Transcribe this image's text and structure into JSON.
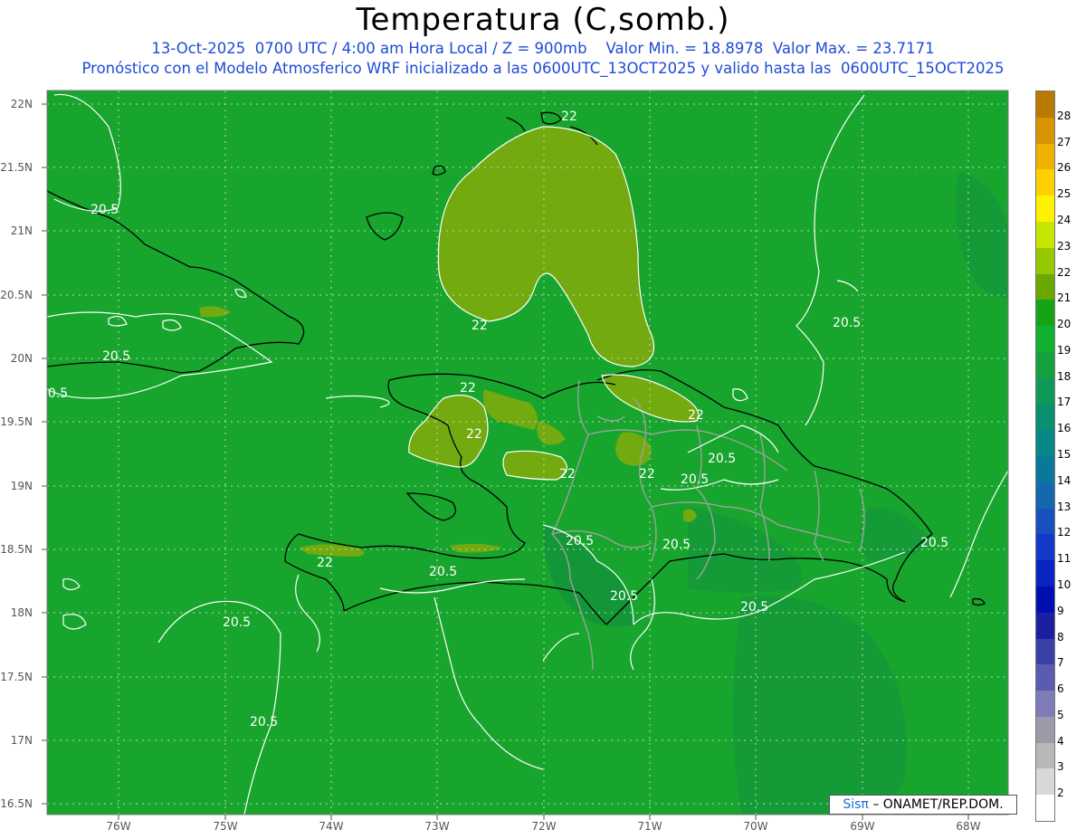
{
  "title": "Temperatura (C,somb.)",
  "subtitle1": "13-Oct-2025  0700 UTC / 4:00 am Hora Local / Z = 900mb    Valor Min. = 18.8978  Valor Max. = 23.7171",
  "subtitle2": "Pronóstico con el Modelo Atmosferico WRF inicializado a las 0600UTC_13OCT2025 y valido hasta las  0600UTC_15OCT2025",
  "credit": {
    "logo": "Sisπ",
    "text": "– ONAMET/REP.DOM."
  },
  "lat_labels": [
    "22N",
    "21.5N",
    "21N",
    "20.5N",
    "20N",
    "19.5N",
    "19N",
    "18.5N",
    "18N",
    "17.5N",
    "17N",
    "16.5N"
  ],
  "lon_labels": [
    "76W",
    "75W",
    "74W",
    "73W",
    "72W",
    "71W",
    "70W",
    "69W",
    "68W"
  ],
  "contour_labels": [
    "22",
    "20.5"
  ],
  "colorbar": {
    "labels": [
      "28",
      "27",
      "26",
      "25",
      "24",
      "23",
      "22",
      "21",
      "20",
      "19",
      "18",
      "17",
      "16",
      "15",
      "14",
      "13",
      "12",
      "11",
      "10",
      "9",
      "8",
      "7",
      "6",
      "5",
      "4",
      "3",
      "2"
    ],
    "colors": [
      "#b87a00",
      "#d89400",
      "#f0b000",
      "#ffd000",
      "#fff200",
      "#c6e600",
      "#96c800",
      "#6aa800",
      "#16a416",
      "#12b030",
      "#16a040",
      "#109858",
      "#0a9070",
      "#068888",
      "#0a7898",
      "#1468b0",
      "#1850c0",
      "#1438c8",
      "#0a24c0",
      "#0010b0",
      "#1a20a0",
      "#3a40a8",
      "#5a5cb0",
      "#7e7cb8",
      "#9a9aa8",
      "#b8b8b8",
      "#d8d8d8",
      "#ffffff"
    ]
  }
}
